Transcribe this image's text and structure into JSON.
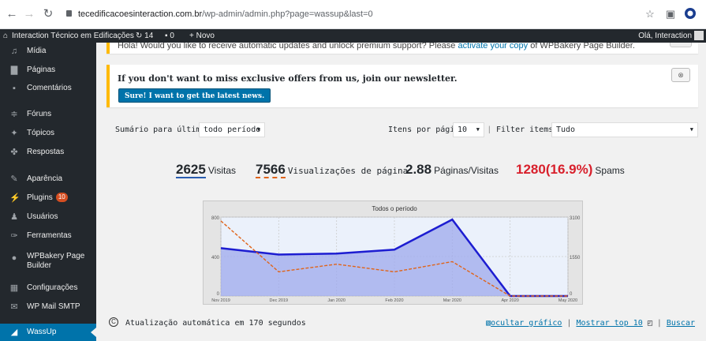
{
  "browser": {
    "url_host": "tecedificacoesinteraction.com.br",
    "url_path": "/wp-admin/admin.php?page=wassup&last=0"
  },
  "adminbar": {
    "site_name": "Interaction Técnico em Edificações",
    "updates_count": "14",
    "comments_count": "0",
    "new_label": "Novo",
    "howdy": "Olá, Interaction"
  },
  "sidebar": {
    "items": [
      {
        "label": "Mídia",
        "icon": "media-icon"
      },
      {
        "label": "Páginas",
        "icon": "pages-icon"
      },
      {
        "label": "Comentários",
        "icon": "comments-icon"
      },
      {
        "label": "Fóruns",
        "icon": "forums-icon"
      },
      {
        "label": "Tópicos",
        "icon": "topics-icon"
      },
      {
        "label": "Respostas",
        "icon": "replies-icon"
      },
      {
        "label": "Aparência",
        "icon": "appearance-icon"
      },
      {
        "label": "Plugins",
        "icon": "plugins-icon",
        "badge": "10"
      },
      {
        "label": "Usuários",
        "icon": "users-icon"
      },
      {
        "label": "Ferramentas",
        "icon": "tools-icon"
      },
      {
        "label": "WPBakery Page",
        "label2": "Builder",
        "icon": "wpbakery-icon"
      },
      {
        "label": "Configurações",
        "icon": "settings-icon"
      },
      {
        "label": "WP Mail SMTP",
        "icon": "mail-icon"
      },
      {
        "label": "WassUp",
        "icon": "wassup-icon"
      }
    ]
  },
  "notices": {
    "update_text": "Hola! Would you like to receive automatic updates and unlock premium support? Please",
    "update_link": "activate your copy",
    "update_suffix": "of WPBakery Page Builder.",
    "newsletter_text": "If you don't want to miss exclusive offers from us, join our newsletter.",
    "newsletter_button": "Sure! I want to get the latest news."
  },
  "filters": {
    "summary_label": "Sumário para último(s):",
    "summary_value": "todo período",
    "per_page_label": "Itens por página:",
    "per_page_value": "10",
    "filter_label": "Filter items for:",
    "filter_value": "Tudo"
  },
  "stats": {
    "visits": "2625",
    "visits_label": "Visitas",
    "pageviews": "7566",
    "pageviews_label": "Visualizações de página",
    "pages_per_visit": "2.88",
    "pages_per_visit_label": "Páginas/Visitas",
    "spams": "1280",
    "spams_pct": "(16.9%)",
    "spams_label": "Spams"
  },
  "chart_data": {
    "type": "line",
    "title": "Todos o período",
    "x": [
      "Nov 2019",
      "Dec 2019",
      "Jan 2020",
      "Feb 2020",
      "Mar 2020",
      "Apr 2020",
      "May 2020"
    ],
    "y_left_ticks": [
      "0",
      "400",
      "800"
    ],
    "y_right_ticks": [
      "0",
      "1550",
      "3100"
    ],
    "ylim_left": [
      0,
      800
    ],
    "ylim_right": [
      0,
      3100
    ],
    "series": [
      {
        "axis": "left",
        "color": "#1d1dd1",
        "values": [
          485,
          420,
          430,
          470,
          775,
          0,
          0
        ]
      },
      {
        "axis": "right",
        "color": "#e0641a",
        "values": [
          2950,
          950,
          1250,
          950,
          1350,
          0,
          0
        ]
      }
    ],
    "grid": true
  },
  "footer": {
    "autorefresh": "Atualização automática em 170 segundos",
    "hide_chart": "ocultar gráfico",
    "show_top": "Mostrar top 10",
    "search": "Buscar"
  }
}
